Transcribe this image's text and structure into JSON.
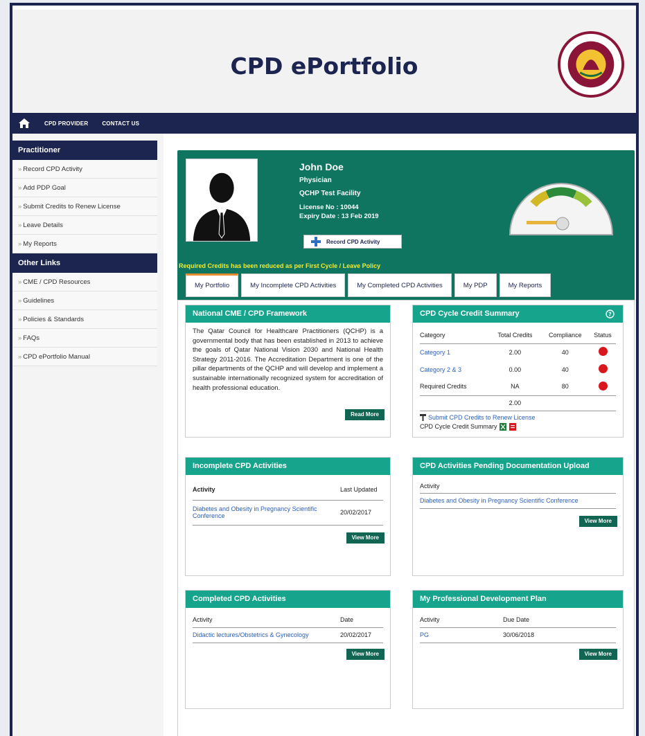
{
  "app": {
    "title": "CPD ePortfolio"
  },
  "nav": {
    "links": [
      "CPD PROVIDER",
      "CONTACT US"
    ]
  },
  "sidebar": {
    "practitioner_title": "Practitioner",
    "practitioner_items": [
      "Record CPD Activity",
      "Add PDP Goal",
      "Submit Credits to Renew License",
      "Leave Details",
      "My Reports"
    ],
    "other_title": "Other Links",
    "other_items": [
      "CME / CPD Resources",
      "Guidelines",
      "Policies & Standards",
      "FAQs",
      "CPD ePortfolio Manual"
    ]
  },
  "profile": {
    "name": "John Doe",
    "role": "Physician",
    "facility": "QCHP Test Facility",
    "license": "License No : 10044",
    "expiry": "Expiry Date : 13 Feb 2019",
    "record_button": "Record CPD Activity",
    "notice": "Required Credits has been reduced as per First Cycle / Leave Policy"
  },
  "tabs": [
    "My Portfolio",
    "My Incomplete CPD Activities",
    "My Completed CPD Activities",
    "My PDP",
    "My Reports"
  ],
  "framework": {
    "title": "National CME / CPD Framework",
    "text": "The Qatar Council for Healthcare Practitioners (QCHP) is a governmental body that has been established in 2013 to achieve the goals of Qatar National Vision 2030 and National Health Strategy 2011-2016. The Accreditation Department is one of the pillar departments of the QCHP and will develop and implement a sustainable internationally recognized system for accreditation of health professional education.",
    "button": "Read More"
  },
  "credit_summary": {
    "title": "CPD Cycle Credit Summary",
    "headers": [
      "Category",
      "Total Credits",
      "Compliance",
      "Status"
    ],
    "rows": [
      {
        "category": "Category 1",
        "credits": "2.00",
        "compliance": "40",
        "link": true
      },
      {
        "category": "Category 2 & 3",
        "credits": "0.00",
        "compliance": "40",
        "link": true
      },
      {
        "category": "Required Credits",
        "credits": "NA",
        "compliance": "80",
        "link": false
      }
    ],
    "total": "2.00",
    "submit_link": "Submit CPD Credits to Renew License",
    "summary_label": "CPD Cycle Credit Summary"
  },
  "incomplete": {
    "title": "Incomplete CPD Activities",
    "headers": [
      "Activity",
      "Last Updated"
    ],
    "rows": [
      {
        "activity": "Diabetes and Obesity in Pregnancy Scientific Conference",
        "date": "20/02/2017"
      }
    ],
    "button": "View More"
  },
  "pending": {
    "title": "CPD Activities Pending Documentation Upload",
    "headers": [
      "Activity"
    ],
    "rows": [
      {
        "activity": "Diabetes and Obesity in Pregnancy Scientific Conference"
      }
    ],
    "button": "View More"
  },
  "completed": {
    "title": "Completed CPD Activities",
    "headers": [
      "Activity",
      "Date"
    ],
    "rows": [
      {
        "activity": "Didactic lectures/Obstetrics & Gynecology",
        "date": "20/02/2017"
      }
    ],
    "button": "View More"
  },
  "pdp": {
    "title": "My Professional Development Plan",
    "headers": [
      "Activity",
      "Due Date"
    ],
    "rows": [
      {
        "activity": "PG",
        "date": "30/06/2018"
      }
    ],
    "button": "View More"
  },
  "colors": {
    "navy": "#1c2550",
    "teal": "#0f7561",
    "teal_light": "#16a48c",
    "red": "#d9161e",
    "gold": "#f3ec2b"
  }
}
